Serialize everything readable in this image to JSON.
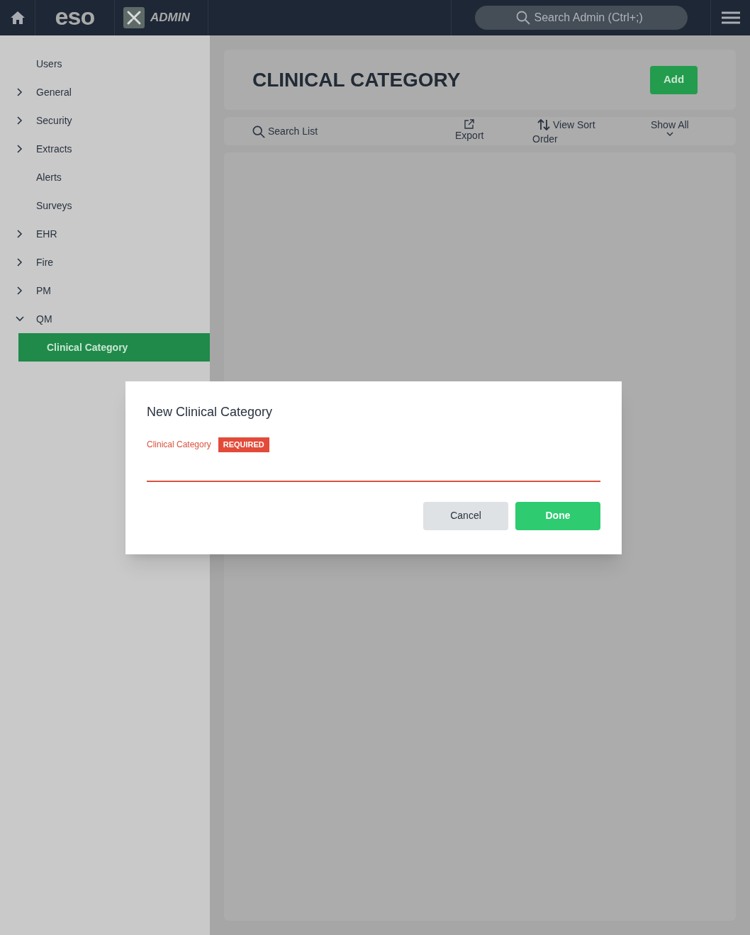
{
  "top_bar": {
    "brand": "eso",
    "app_name": "ADMIN",
    "search": {
      "placeholder": "Search Admin (Ctrl+;)"
    }
  },
  "sidebar": {
    "items": [
      {
        "label": "Users",
        "kind": "link",
        "selected": false
      },
      {
        "label": "General",
        "kind": "group",
        "expanded": false,
        "selected": false
      },
      {
        "label": "Security",
        "kind": "group",
        "expanded": false,
        "selected": false
      },
      {
        "label": "Extracts",
        "kind": "group",
        "expanded": false,
        "selected": false
      },
      {
        "label": "Alerts",
        "kind": "link",
        "selected": false
      },
      {
        "label": "Surveys",
        "kind": "link",
        "selected": false
      },
      {
        "label": "EHR",
        "kind": "group",
        "expanded": false,
        "selected": false
      },
      {
        "label": "Fire",
        "kind": "group",
        "expanded": false,
        "selected": false
      },
      {
        "label": "PM",
        "kind": "group",
        "expanded": false,
        "selected": false
      },
      {
        "label": "QM",
        "kind": "group",
        "expanded": true,
        "selected": false,
        "children": [
          {
            "label": "Clinical Category",
            "selected": true
          }
        ]
      }
    ]
  },
  "header": {
    "title": "CLINICAL CATEGORY",
    "add_button": "Add"
  },
  "toolbar": {
    "search": "Search List",
    "export": "Export",
    "sort": "View Sort Order",
    "filter": "Show All"
  },
  "dialog": {
    "title": "New Clinical Category",
    "field": {
      "label": "Clinical Category",
      "badge": "REQUIRED"
    },
    "buttons": [
      {
        "label": "Cancel",
        "kind": "secondary"
      },
      {
        "label": "Done",
        "kind": "primary"
      }
    ]
  }
}
